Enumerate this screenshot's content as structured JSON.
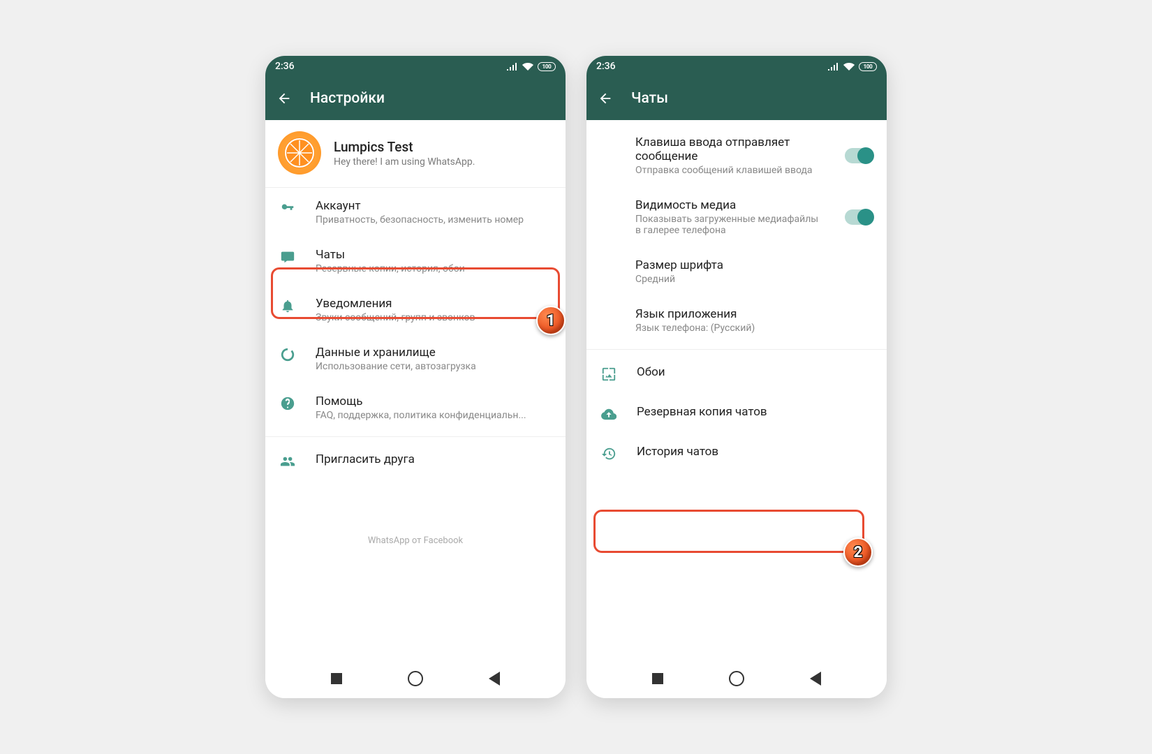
{
  "statusbar": {
    "time": "2:36",
    "battery": "100"
  },
  "left": {
    "appbar_title": "Настройки",
    "profile": {
      "name": "Lumpics Test",
      "status": "Hey there! I am using WhatsApp."
    },
    "items": [
      {
        "title": "Аккаунт",
        "sub": "Приватность, безопасность, изменить номер"
      },
      {
        "title": "Чаты",
        "sub": "Резервные копии, история, обои"
      },
      {
        "title": "Уведомления",
        "sub": "Звуки сообщений, групп и звонков"
      },
      {
        "title": "Данные и хранилище",
        "sub": "Использование сети, автозагрузка"
      },
      {
        "title": "Помощь",
        "sub": "FAQ, поддержка, политика конфиденциальн..."
      },
      {
        "title": "Пригласить друга"
      }
    ],
    "footer": "WhatsApp от Facebook",
    "badge": "1"
  },
  "right": {
    "appbar_title": "Чаты",
    "items": [
      {
        "title": "Клавиша ввода отправляет сообщение",
        "sub": "Отправка сообщений клавишей ввода"
      },
      {
        "title": "Видимость медиа",
        "sub": "Показывать загруженные медиафайлы в галерее телефона"
      },
      {
        "title": "Размер шрифта",
        "sub": "Средний"
      },
      {
        "title": "Язык приложения",
        "sub": "Язык телефона: (Русский)"
      },
      {
        "title": "Обои"
      },
      {
        "title": "Резервная копия чатов"
      },
      {
        "title": "История чатов"
      }
    ],
    "badge": "2"
  }
}
